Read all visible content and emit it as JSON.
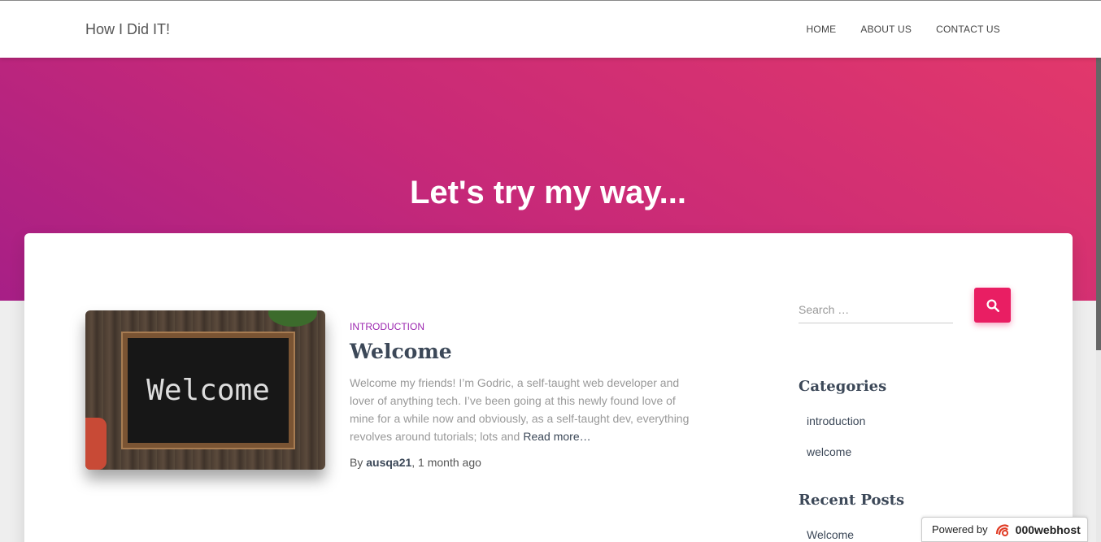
{
  "site": {
    "brand": "How I Did IT!"
  },
  "nav": {
    "items": [
      {
        "label": "HOME"
      },
      {
        "label": "ABOUT US"
      },
      {
        "label": "CONTACT US"
      }
    ]
  },
  "hero": {
    "title": "Let's try my way..."
  },
  "post": {
    "thumbnail_text": "Welcome",
    "category": "INTRODUCTION",
    "title": "Welcome",
    "excerpt": "Welcome my friends! I’m Godric, a self-taught web developer and lover of anything tech. I’ve been going at this newly found love of mine for a while now and obviously, as a self-taught dev, everything revolves around tutorials; lots and",
    "read_more": "Read more…",
    "by_label": "By",
    "author": "ausqa21",
    "date": ", 1 month ago"
  },
  "sidebar": {
    "search_placeholder": "Search …",
    "categories_title": "Categories",
    "categories": [
      {
        "label": "introduction"
      },
      {
        "label": "welcome"
      }
    ],
    "recent_title": "Recent Posts",
    "recent": [
      {
        "label": "Welcome"
      }
    ]
  },
  "badge": {
    "powered_label": "Powered by",
    "host_name": "000webhost"
  },
  "colors": {
    "accent": "#e91e63",
    "category": "#9c27b0",
    "heading": "#3c4858"
  }
}
